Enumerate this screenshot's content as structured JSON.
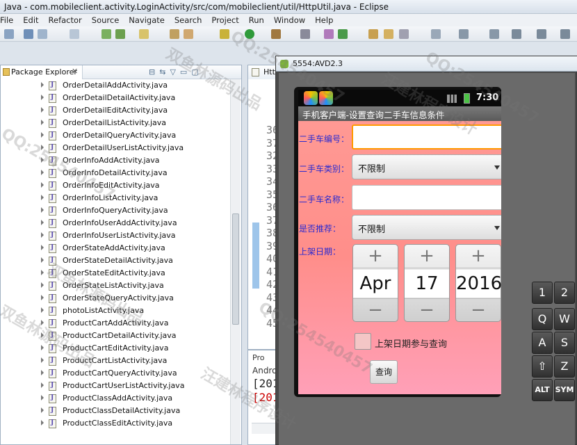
{
  "window": {
    "title": "Java - com.mobileclient.activity.LoginActivity/src/com/mobileclient/util/HttpUtil.java - Eclipse"
  },
  "menu": [
    "File",
    "Edit",
    "Refactor",
    "Source",
    "Navigate",
    "Search",
    "Project",
    "Run",
    "Window",
    "Help"
  ],
  "package_explorer": {
    "title": "Package Explorer",
    "close": "✕",
    "buttons": [
      "⊟",
      "⇆",
      "▽",
      "▭",
      "▢"
    ],
    "files": [
      "OrderDetailAddActivity.java",
      "OrderDetailDetailActivity.java",
      "OrderDetailEditActivity.java",
      "OrderDetailListActivity.java",
      "OrderDetailQueryActivity.java",
      "OrderDetailUserListActivity.java",
      "OrderInfoAddActivity.java",
      "OrderInfoDetailActivity.java",
      "OrderInfoEditActivity.java",
      "OrderInfoListActivity.java",
      "OrderInfoQueryActivity.java",
      "OrderInfoUserAddActivity.java",
      "OrderInfoUserListActivity.java",
      "OrderStateAddActivity.java",
      "OrderStateDetailActivity.java",
      "OrderStateEditActivity.java",
      "OrderStateListActivity.java",
      "OrderStateQueryActivity.java",
      "photoListActivity.java",
      "ProductCartAddActivity.java",
      "ProductCartDetailActivity.java",
      "ProductCartEditActivity.java",
      "ProductCartListActivity.java",
      "ProductCartQueryActivity.java",
      "ProductCartUserListActivity.java",
      "ProductClassAddActivity.java",
      "ProductClassDetailActivity.java",
      "ProductClassEditActivity.java"
    ]
  },
  "editor": {
    "tab": "Htt",
    "line_numbers": [
      "36",
      "37",
      "32",
      "33",
      "34",
      "35",
      "36",
      "37",
      "38",
      "39",
      "40",
      "41",
      "42",
      "43",
      "44",
      "45"
    ]
  },
  "console": {
    "tab": "Pro",
    "line1": "Andro",
    "line2": "[201",
    "line3": "[201"
  },
  "emulator": {
    "title": "5554:AVD2.3",
    "status_time": "7:30",
    "app_title": "手机客户端-设置查询二手车信息条件",
    "fields": {
      "car_no_label": "二手车编号：",
      "car_type_label": "二手车类别：",
      "car_type_value": "不限制",
      "car_name_label": "二手车名称：",
      "recommend_label": "是否推荐：",
      "recommend_value": "不限制",
      "date_label": "上架日期："
    },
    "date_picker": {
      "month": "Apr",
      "day": "17",
      "year": "2016",
      "plus": "+",
      "minus": "−"
    },
    "checkbox_label": "上架日期参与查询",
    "query_button": "查询",
    "keys": [
      "1",
      "2",
      "Q",
      "W",
      "A",
      "S",
      "⇧",
      "Z",
      "ALT",
      "SYM"
    ]
  },
  "watermarks": [
    "QQ:254540457",
    "汪建林程序设计",
    "双鱼林源码出品"
  ]
}
